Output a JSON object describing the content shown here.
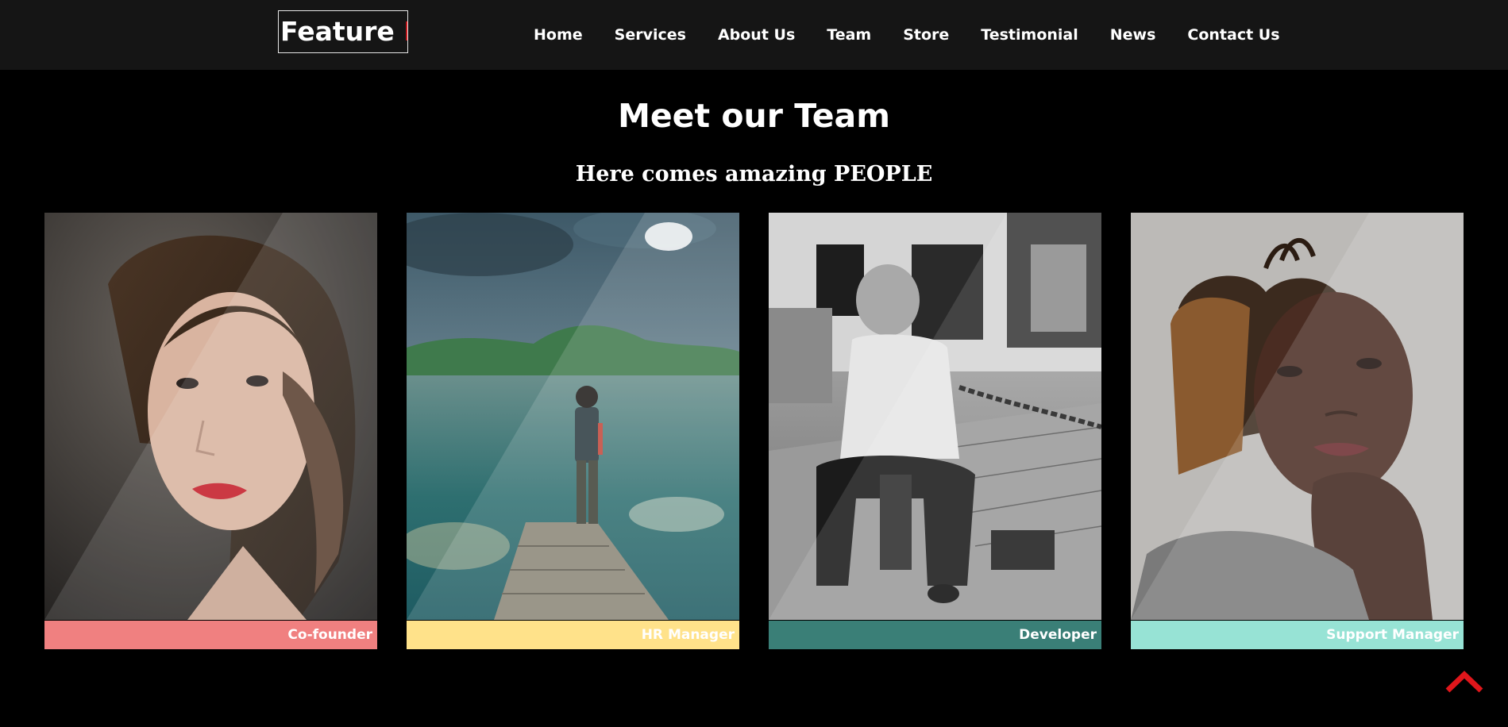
{
  "brand": {
    "text": "Feature ",
    "accent": "D",
    "accent_color": "#e0161b"
  },
  "nav": {
    "items": [
      {
        "label": "Home"
      },
      {
        "label": "Services"
      },
      {
        "label": "About Us"
      },
      {
        "label": "Team"
      },
      {
        "label": "Store"
      },
      {
        "label": "Testimonial"
      },
      {
        "label": "News"
      },
      {
        "label": "Contact Us"
      }
    ]
  },
  "section": {
    "title": "Meet our Team",
    "subtitle": "Here comes amazing PEOPLE"
  },
  "team": [
    {
      "role": "Co-founder",
      "color": "#f08080"
    },
    {
      "role": "HR Manager",
      "color": "#ffe28a"
    },
    {
      "role": "Developer",
      "color": "#3a7f77"
    },
    {
      "role": "Support Manager",
      "color": "#97e3d5"
    }
  ],
  "scroll_top": {
    "icon": "chevron-up-icon",
    "color": "#e0161b"
  }
}
